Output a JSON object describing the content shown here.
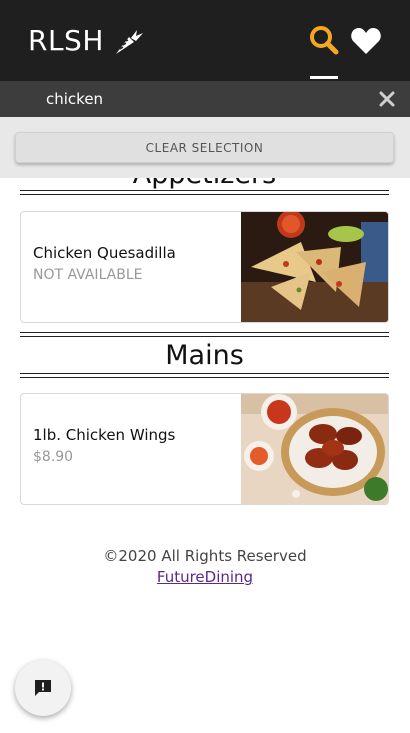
{
  "header": {
    "logo_text": "RLSH",
    "logo_icon": "carrot-icon",
    "search_icon": "search-icon",
    "favorites_icon": "heart-icon",
    "active_color": "#f5a623"
  },
  "search": {
    "value": "chicken",
    "clear_icon": "close-icon"
  },
  "filter": {
    "clear_label": "CLEAR SELECTION"
  },
  "sections": [
    {
      "title": "Appetizers",
      "items": [
        {
          "name": "Chicken Quesadilla",
          "price": "NOT AVAILABLE"
        }
      ]
    },
    {
      "title": "Mains",
      "items": [
        {
          "name": "1lb. Chicken Wings",
          "price": "$8.90"
        }
      ]
    }
  ],
  "footer": {
    "copyright": "©2020 All Rights Reserved",
    "link": "FutureDining"
  },
  "feedback": {
    "icon": "feedback-icon"
  }
}
